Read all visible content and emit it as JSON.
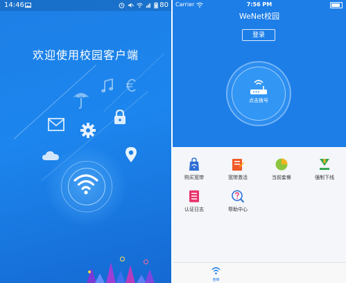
{
  "left_screen": {
    "status_bar": {
      "time": "14:46",
      "battery": "80"
    },
    "welcome_text": "欢迎使用校园客户端",
    "icons": [
      "umbrella-icon",
      "music-note-icon",
      "euro-icon",
      "mail-icon",
      "gear-icon",
      "lock-icon",
      "cloud-icon",
      "location-pin-icon",
      "wifi-icon"
    ]
  },
  "right_screen": {
    "status_bar": {
      "carrier": "Carrier",
      "time": "7:56 PM"
    },
    "title": "WeNet校园",
    "login_label": "登录",
    "dial_label": "点击拨号",
    "menu": [
      {
        "label": "购买宽带",
        "icon": "bag-icon",
        "color": "#2f6fd6"
      },
      {
        "label": "宽带激活",
        "icon": "card-icon",
        "color": "#f05a28"
      },
      {
        "label": "当前套餐",
        "icon": "pie-chart-icon",
        "color": "#f2b320"
      },
      {
        "label": "强制下线",
        "icon": "download-arrow-icon",
        "color": "#35a853"
      },
      {
        "label": "认证日志",
        "icon": "list-icon",
        "color": "#e8336b"
      },
      {
        "label": "帮助中心",
        "icon": "help-search-icon",
        "color": "#2f6fd6"
      }
    ],
    "tab_label": "宽带",
    "accent_color": "#1d7ee8"
  }
}
